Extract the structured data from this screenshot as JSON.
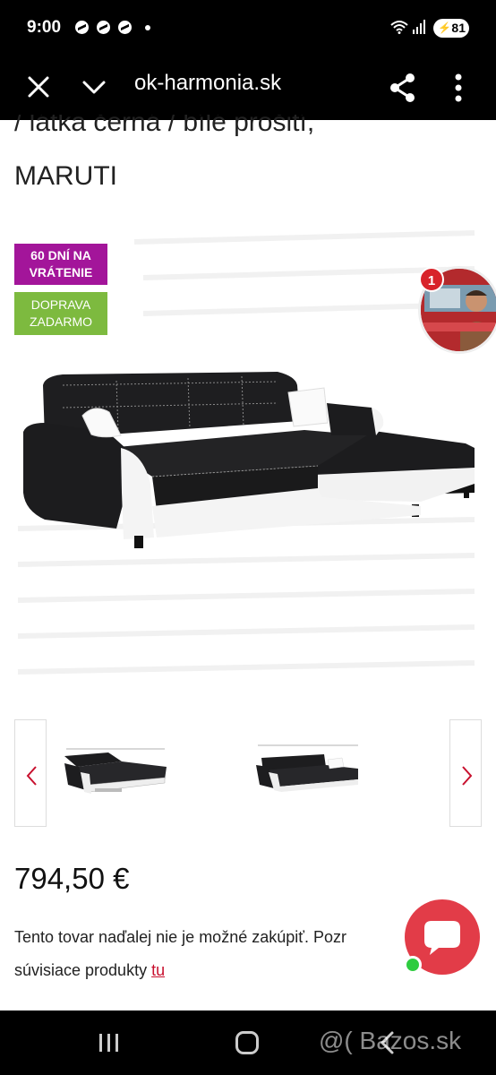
{
  "status_bar": {
    "time": "9:00",
    "battery": "81",
    "icons": [
      "messenger-icon",
      "messenger-icon",
      "messenger-icon",
      "dot-icon",
      "wifi-icon",
      "signal-icon",
      "battery-icon"
    ]
  },
  "browser": {
    "url": "ok-harmonia.sk",
    "icons": [
      "close-icon",
      "chevron-down-icon",
      "share-icon",
      "more-vert-icon"
    ]
  },
  "product": {
    "title_line1": "/ látka černá / bílé prošití,",
    "title_line2": "MARUTI",
    "badge_return": [
      "60 DNÍ NA",
      "VRÁTENIE"
    ],
    "badge_shipping": [
      "DOPRAVA",
      "ZADARMO"
    ],
    "price": "794,50 €",
    "notice_line1": "Tento tovar naďalej nie je možné zakúpiť. Pozr",
    "notice_line2": "súvisiace produkty ",
    "notice_link": "tu"
  },
  "agent": {
    "badge_count": "1"
  },
  "gallery": {
    "prev_icon": "chevron-left-icon",
    "next_icon": "chevron-right-icon"
  },
  "nav": {
    "watermark": "@( Bazos.sk"
  },
  "colors": {
    "badge_return": "#a3159a",
    "badge_shipping": "#7dba3f",
    "chat": "#e23c48",
    "link": "#c8102e",
    "arrow": "#c8102e"
  }
}
